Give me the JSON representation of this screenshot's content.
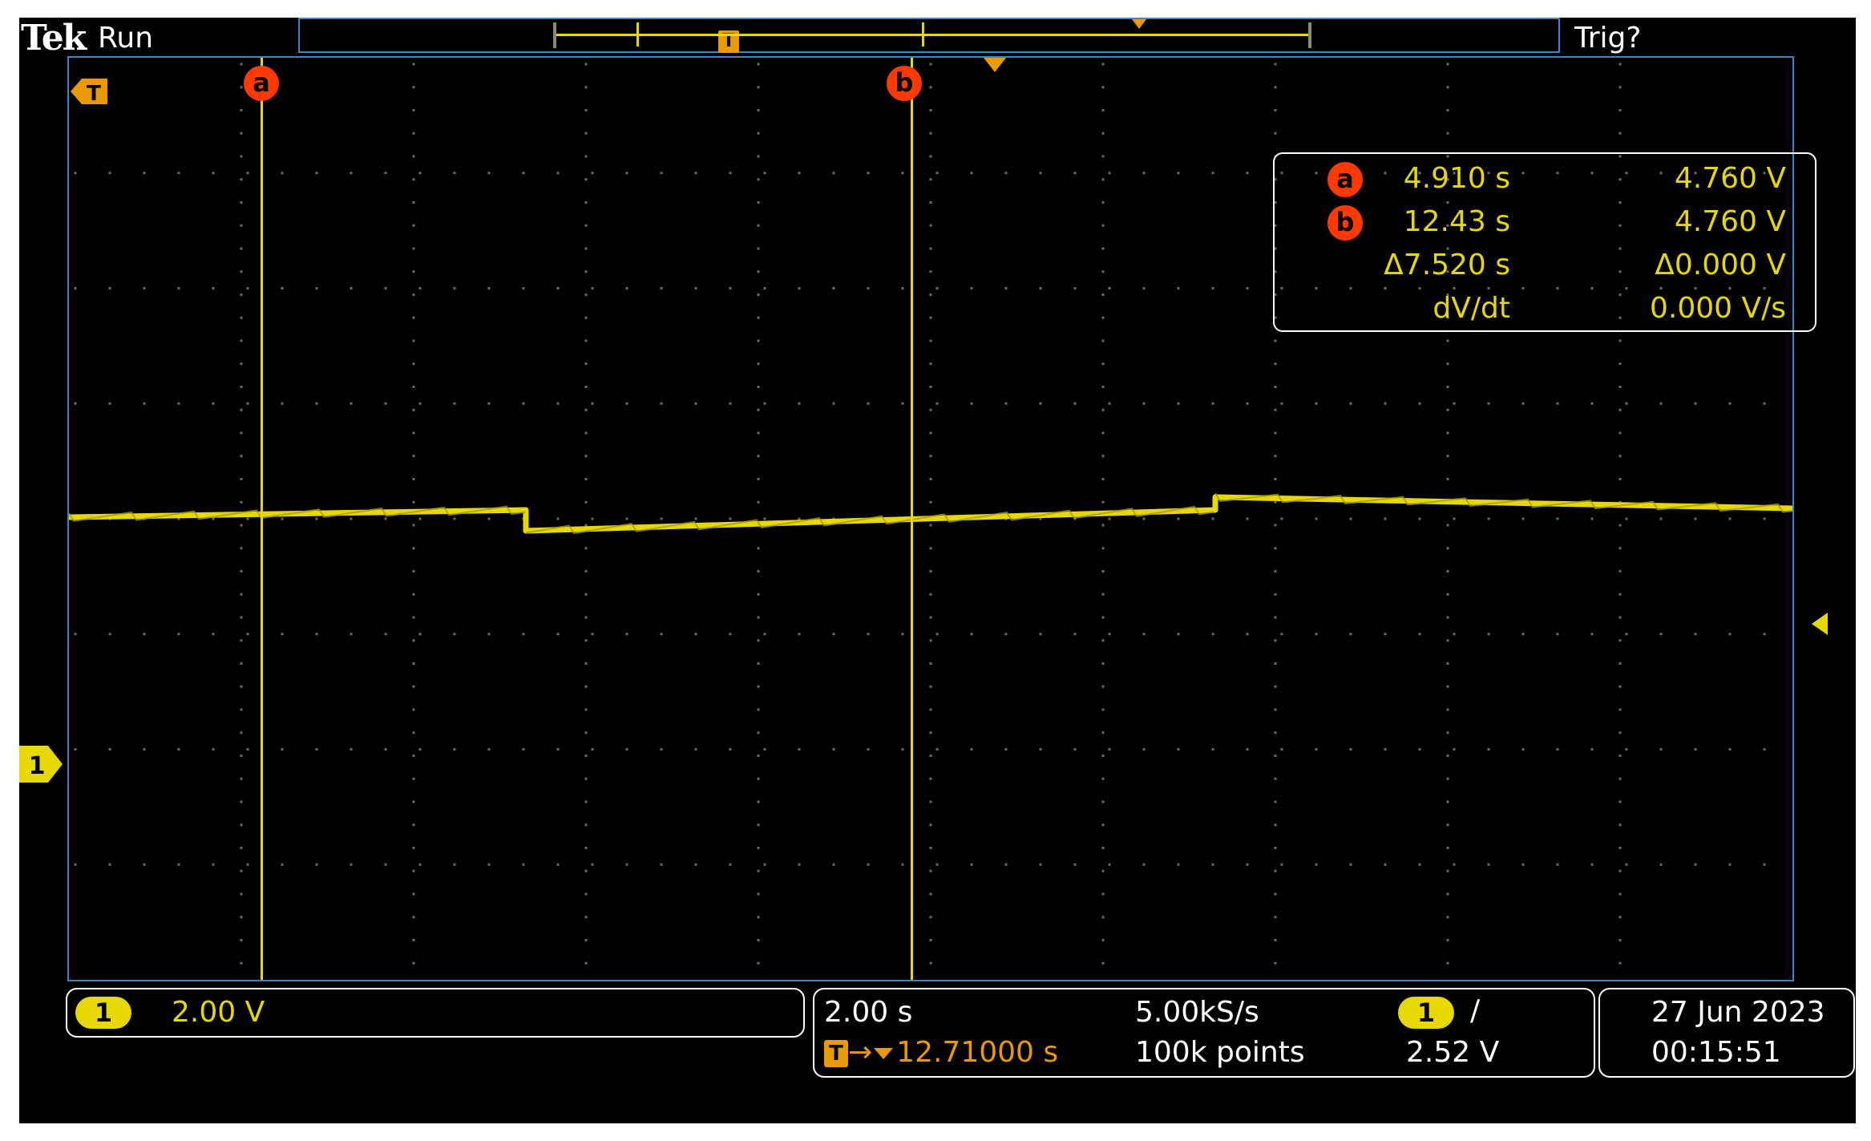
{
  "header": {
    "brand": "Tek",
    "run_status": "Run",
    "trigger_state": "Trig?"
  },
  "icons": {
    "trigger": "T",
    "cursor_a": "a",
    "cursor_b": "b",
    "channel": "1",
    "rising_edge": "/"
  },
  "cursor_readout": {
    "a": {
      "time": "4.910 s",
      "voltage": "4.760 V"
    },
    "b": {
      "time": "12.43 s",
      "voltage": "4.760 V"
    },
    "delta": {
      "time": "Δ7.520 s",
      "voltage": "Δ0.000 V"
    },
    "rate": {
      "label": "dV/dt",
      "value": "0.000 V/s"
    }
  },
  "channel1": {
    "scale": "2.00 V"
  },
  "timebase": {
    "scale": "2.00 s",
    "sample_rate": "5.00kS/s",
    "record_length": "100k points",
    "trigger_delay": "12.71000 s"
  },
  "trigger": {
    "source": "1",
    "level": "2.52 V"
  },
  "datetime": {
    "date": "27 Jun  2023",
    "time": "00:15:51"
  },
  "colors": {
    "trace": "#e6d800",
    "cursor": "#e6d800",
    "cursor_badge": "#ff3a00",
    "trigger_marker": "#e89a00",
    "frame": "#3a86c8",
    "background": "#000000"
  }
}
